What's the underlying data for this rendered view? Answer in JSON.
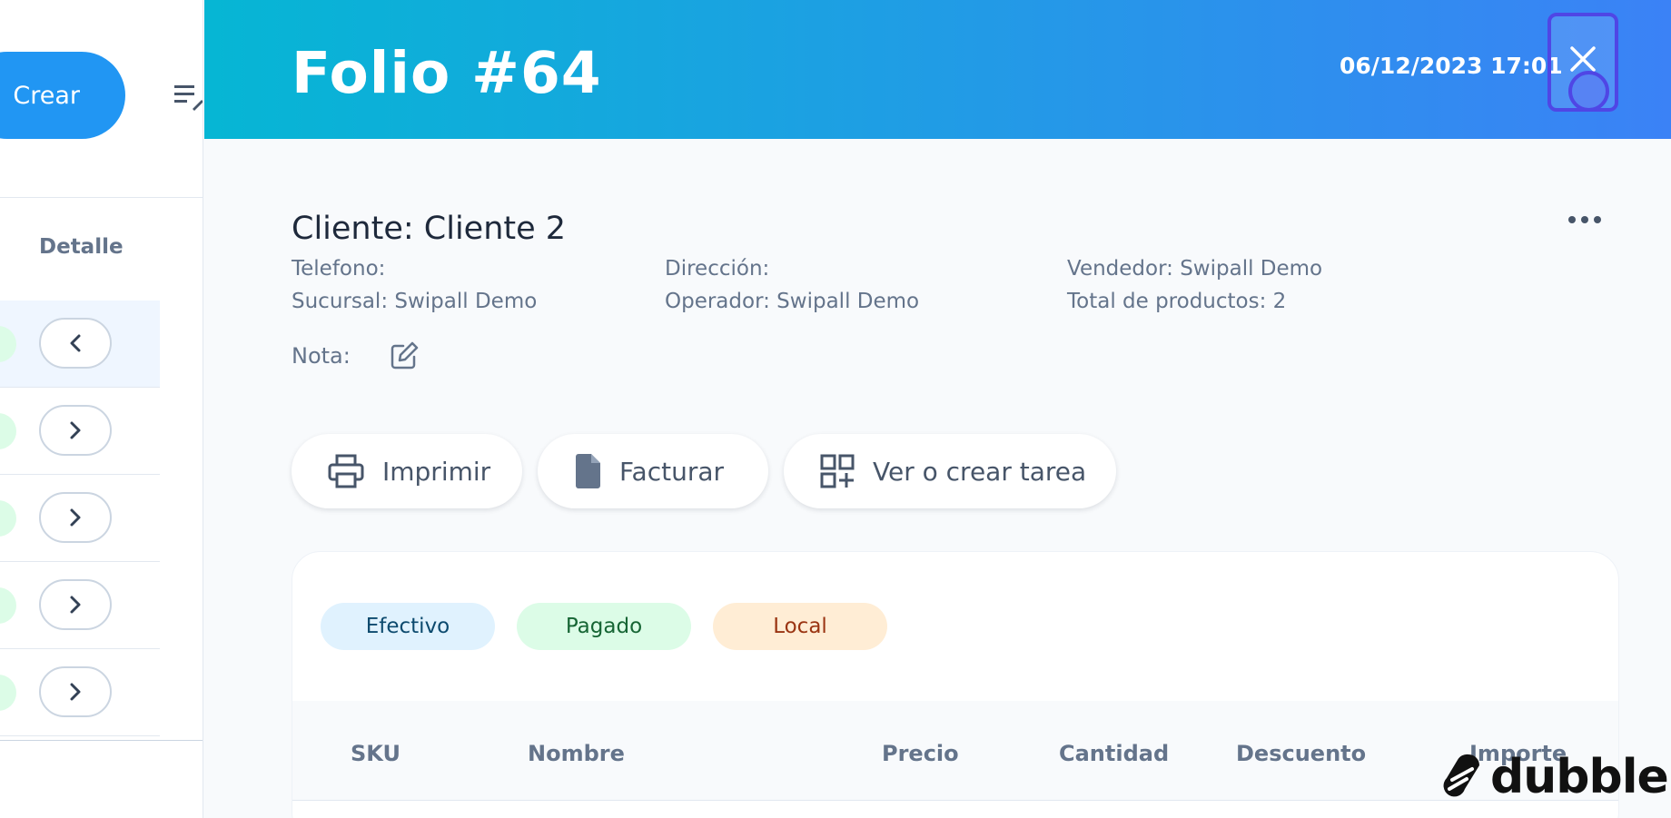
{
  "left": {
    "create_label": "Crear",
    "detail_header": "Detalle"
  },
  "drawer": {
    "title": "Folio #64",
    "date": "06/12/2023 17:01",
    "client": "Cliente: Cliente 2",
    "info": {
      "telefono": "Telefono:",
      "direccion": "Dirección:",
      "vendedor": "Vendedor: Swipall Demo",
      "sucursal": "Sucursal: Swipall Demo",
      "operador": "Operador: Swipall Demo",
      "total_productos": "Total de productos: 2"
    },
    "nota_label": "Nota:",
    "actions": {
      "print": "Imprimir",
      "invoice": "Facturar",
      "task": "Ver o crear tarea"
    },
    "tags": {
      "payment": "Efectivo",
      "status": "Pagado",
      "type": "Local"
    },
    "table_headers": [
      "SKU",
      "Nombre",
      "Precio",
      "Cantidad",
      "Descuento",
      "Importe"
    ]
  },
  "watermark": "dubble",
  "colors": {
    "header_start": "#06b6d4",
    "header_end": "#3b82f6",
    "create_button": "#2196f3"
  }
}
